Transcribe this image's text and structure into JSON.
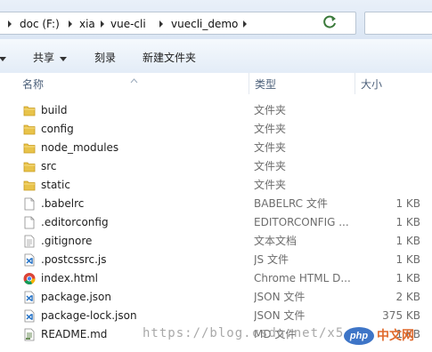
{
  "address_bar": {
    "crumbs": [
      "doc (F:)",
      "xia",
      "vue-cli",
      "vuecli_demo"
    ]
  },
  "toolbar": {
    "share_label": "共享",
    "burn_label": "刻录",
    "new_folder_label": "新建文件夹"
  },
  "columns": {
    "name": "名称",
    "type": "类型",
    "size": "大小"
  },
  "files": [
    {
      "name": "build",
      "type": "文件夹",
      "size": "",
      "icon": "folder-icon"
    },
    {
      "name": "config",
      "type": "文件夹",
      "size": "",
      "icon": "folder-icon"
    },
    {
      "name": "node_modules",
      "type": "文件夹",
      "size": "",
      "icon": "folder-icon"
    },
    {
      "name": "src",
      "type": "文件夹",
      "size": "",
      "icon": "folder-icon"
    },
    {
      "name": "static",
      "type": "文件夹",
      "size": "",
      "icon": "folder-icon"
    },
    {
      "name": ".babelrc",
      "type": "BABELRC 文件",
      "size": "1 KB",
      "icon": "blank-file-icon"
    },
    {
      "name": ".editorconfig",
      "type": "EDITORCONFIG ...",
      "size": "1 KB",
      "icon": "blank-file-icon"
    },
    {
      "name": ".gitignore",
      "type": "文本文档",
      "size": "1 KB",
      "icon": "text-file-icon"
    },
    {
      "name": ".postcssrc.js",
      "type": "JS 文件",
      "size": "1 KB",
      "icon": "vscode-file-icon"
    },
    {
      "name": "index.html",
      "type": "Chrome HTML D...",
      "size": "1 KB",
      "icon": "chrome-icon"
    },
    {
      "name": "package.json",
      "type": "JSON 文件",
      "size": "2 KB",
      "icon": "vscode-file-icon"
    },
    {
      "name": "package-lock.json",
      "type": "JSON 文件",
      "size": "375 KB",
      "icon": "vscode-file-icon"
    },
    {
      "name": "README.md",
      "type": "MD 文件",
      "size": "1 KB",
      "icon": "md-file-icon"
    }
  ],
  "watermark": {
    "url_text": "https://blog.csdn.net/x5",
    "logo_text": "php",
    "site_text": "中文网"
  },
  "colors": {
    "folder": "#e8c34a",
    "vscode": "#1f6fc5",
    "header_text": "#4c607a",
    "secondary_text": "#6d6d6d"
  }
}
